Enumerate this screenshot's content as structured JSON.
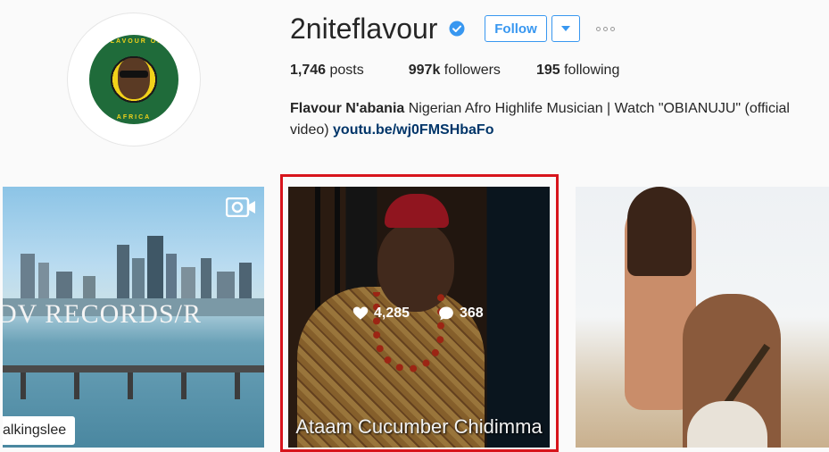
{
  "profile": {
    "username": "2niteflavour",
    "follow_label": "Follow",
    "stats": {
      "posts_count": "1,746",
      "posts_label": "posts",
      "followers_count": "997k",
      "followers_label": "followers",
      "following_count": "195",
      "following_label": "following"
    },
    "bio": {
      "name": "Flavour N'abania",
      "text": "Nigerian Afro Highlife Musician | Watch \"OBIANUJU\" (official video)",
      "link": "youtu.be/wj0FMSHbaFo"
    },
    "avatar_ring_top": "FLAVOUR OF",
    "avatar_ring_bottom": "AFRICA"
  },
  "posts": [
    {
      "watermark": "DV RECORDS/R",
      "user_tag": "alkingslee",
      "icon": "video-camera-icon"
    },
    {
      "likes": "4,285",
      "comments": "368",
      "caption": "Ataam Cucumber Chidimma",
      "selected": true
    },
    {}
  ],
  "colors": {
    "accent": "#3897f0",
    "verified": "#3897f0",
    "selection": "#d7141c",
    "link": "#003569"
  }
}
